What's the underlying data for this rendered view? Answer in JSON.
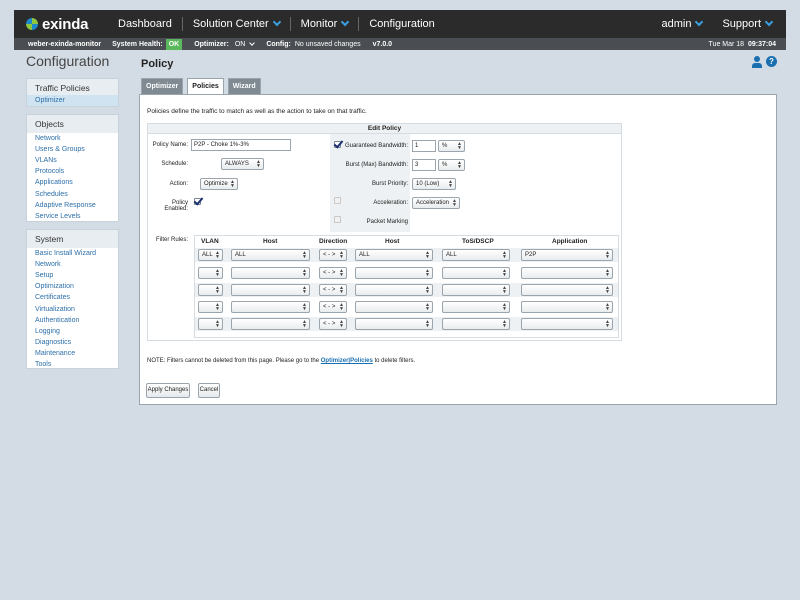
{
  "topbar": {
    "brand": "exinda",
    "nav": [
      "Dashboard",
      "Solution Center",
      "Monitor",
      "Configuration"
    ],
    "user": "admin",
    "support": "Support"
  },
  "status": {
    "device": "weber-exinda-monitor",
    "health_label": "System Health:",
    "health_value": "OK",
    "optimizer_label": "Optimizer:",
    "optimizer_value": "ON",
    "config_label": "Config:",
    "config_value": "No unsaved changes",
    "version": "v7.0.0",
    "date": "Tue Mar 18",
    "time": "09:37:04"
  },
  "sidebar": {
    "heading": "Configuration",
    "traffic": {
      "title": "Traffic Policies",
      "items": [
        "Optimizer"
      ]
    },
    "objects": {
      "title": "Objects",
      "items": [
        "Network",
        "Users & Groups",
        "VLANs",
        "Protocols",
        "Applications",
        "Schedules",
        "Adaptive Response",
        "Service Levels"
      ]
    },
    "system": {
      "title": "System",
      "items": [
        "Basic Install Wizard",
        "Network",
        "Setup",
        "Optimization",
        "Certificates",
        "Virtualization",
        "Authentication",
        "Logging",
        "Diagnostics",
        "Maintenance",
        "Tools"
      ]
    }
  },
  "content": {
    "title": "Policy",
    "tabs": [
      "Optimizer",
      "Policies",
      "Wizard"
    ],
    "intro": "Policies define the traffic to match as well as the action to take on that traffic.",
    "edit_title": "Edit Policy",
    "labels": {
      "policy_name": "Policy Name:",
      "schedule": "Schedule:",
      "action": "Action:",
      "policy_enabled": "Policy Enabled:",
      "guaranteed": "Guaranteed Bandwidth:",
      "burst": "Burst (Max) Bandwidth:",
      "burst_priority": "Burst Priority:",
      "acceleration": "Acceleration:",
      "packet_marking": "Packet Marking",
      "filter_rules": "Filter Rules:"
    },
    "values": {
      "policy_name": "P2P - Choke 1%-3%",
      "schedule": "ALWAYS",
      "action": "Optimize",
      "guaranteed": "1",
      "guaranteed_unit": "%",
      "burst": "3",
      "burst_unit": "%",
      "burst_priority": "10 (Low)",
      "acceleration": "Acceleration"
    },
    "filter_headers": [
      "VLAN",
      "Host",
      "Direction",
      "Host",
      "ToS/DSCP",
      "Application"
    ],
    "filter_row1": [
      "ALL",
      "ALL",
      "< - >",
      "ALL",
      "ALL",
      "P2P"
    ],
    "direction_empty": "< - >",
    "note_prefix": "NOTE: Filters cannot be deleted from this page. Please go to the ",
    "note_link": "Optimizer|Policies",
    "note_suffix": " to delete filters.",
    "apply": "Apply Changes",
    "cancel": "Cancel"
  }
}
